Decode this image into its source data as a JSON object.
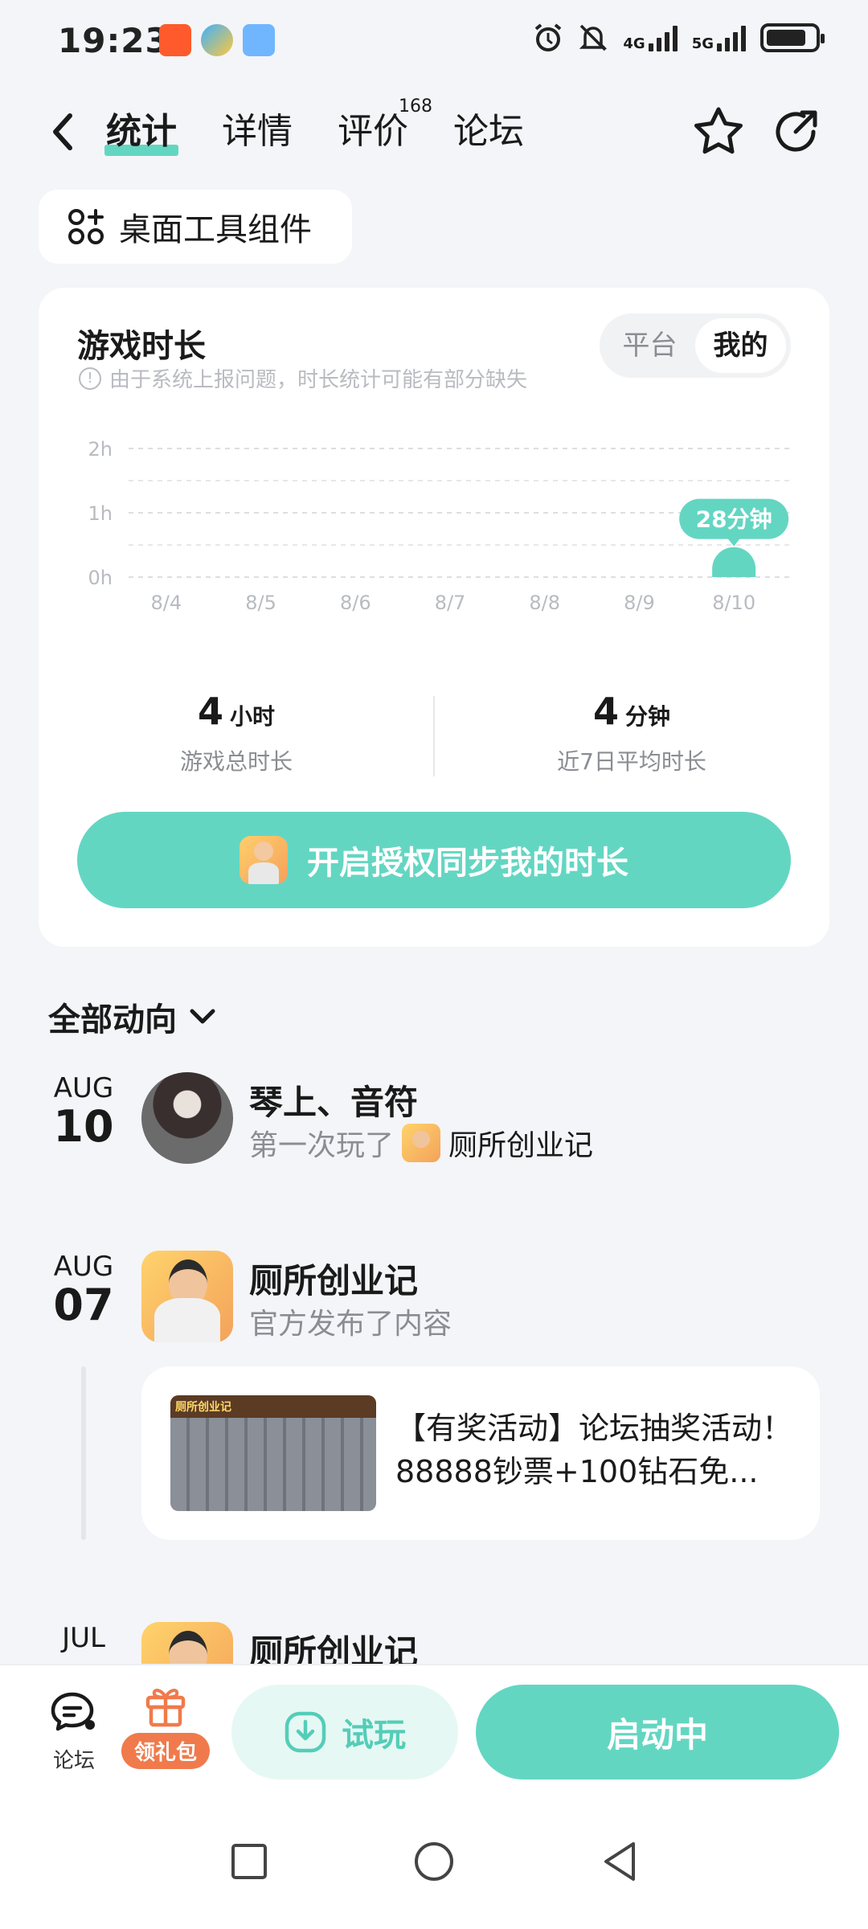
{
  "status_bar": {
    "time": "19:23",
    "network_4g": "4G",
    "network_5g": "5G",
    "app_icons": [
      "taobao-icon",
      "browser-icon",
      "weather-icon"
    ],
    "right_icons": [
      "alarm-icon",
      "mute-icon",
      "signal-4g-icon",
      "signal-5g-icon",
      "battery-icon"
    ]
  },
  "header": {
    "tabs": [
      {
        "label": "统计",
        "active": true
      },
      {
        "label": "详情",
        "active": false
      },
      {
        "label": "评价",
        "active": false,
        "badge": "168"
      },
      {
        "label": "论坛",
        "active": false
      }
    ],
    "icons": [
      "back-icon",
      "star-icon",
      "share-icon"
    ]
  },
  "widget_chip": {
    "label": "桌面工具组件",
    "icon": "widget-grid-icon"
  },
  "playtime_card": {
    "title": "游戏时长",
    "note": "由于系统上报问题，时长统计可能有部分缺失",
    "segment": {
      "options": [
        "平台",
        "我的"
      ],
      "selected": "我的"
    },
    "stats": [
      {
        "value": "4",
        "unit": "小时",
        "caption": "游戏总时长"
      },
      {
        "value": "4",
        "unit": "分钟",
        "caption": "近7日平均时长"
      }
    ],
    "auth_button": "开启授权同步我的时长"
  },
  "chart_data": {
    "type": "bar",
    "categories": [
      "8/4",
      "8/5",
      "8/6",
      "8/7",
      "8/8",
      "8/9",
      "8/10"
    ],
    "values": [
      0,
      0,
      0,
      0,
      0,
      0,
      28
    ],
    "value_unit": "minutes",
    "y_ticks": [
      "2h",
      "1h",
      "0h"
    ],
    "ylim": [
      0,
      120
    ],
    "data_label": "28分钟",
    "grid": true,
    "bar_color": "#63d6c2"
  },
  "feed": {
    "filter_label": "全部动向",
    "items": [
      {
        "month": "AUG",
        "day": "10",
        "name": "琴上、音符",
        "action": "第一次玩了",
        "game": "厕所创业记"
      },
      {
        "month": "AUG",
        "day": "07",
        "name": "厕所创业记",
        "action": "官方发布了内容",
        "post": {
          "line1": "【有奖活动】论坛抽奖活动！",
          "line2": "88888钞票+100钻石免...",
          "thumb_text": "厕所创业记"
        }
      },
      {
        "month": "JUL",
        "name": "厕所创业记"
      }
    ]
  },
  "bottom_bar": {
    "forum_label": "论坛",
    "gift_label": "领礼包",
    "try_label": "试玩",
    "launch_label": "启动中"
  },
  "colors": {
    "accent": "#63d6c2",
    "gift": "#f07a4c",
    "background": "#f4f5f8"
  }
}
